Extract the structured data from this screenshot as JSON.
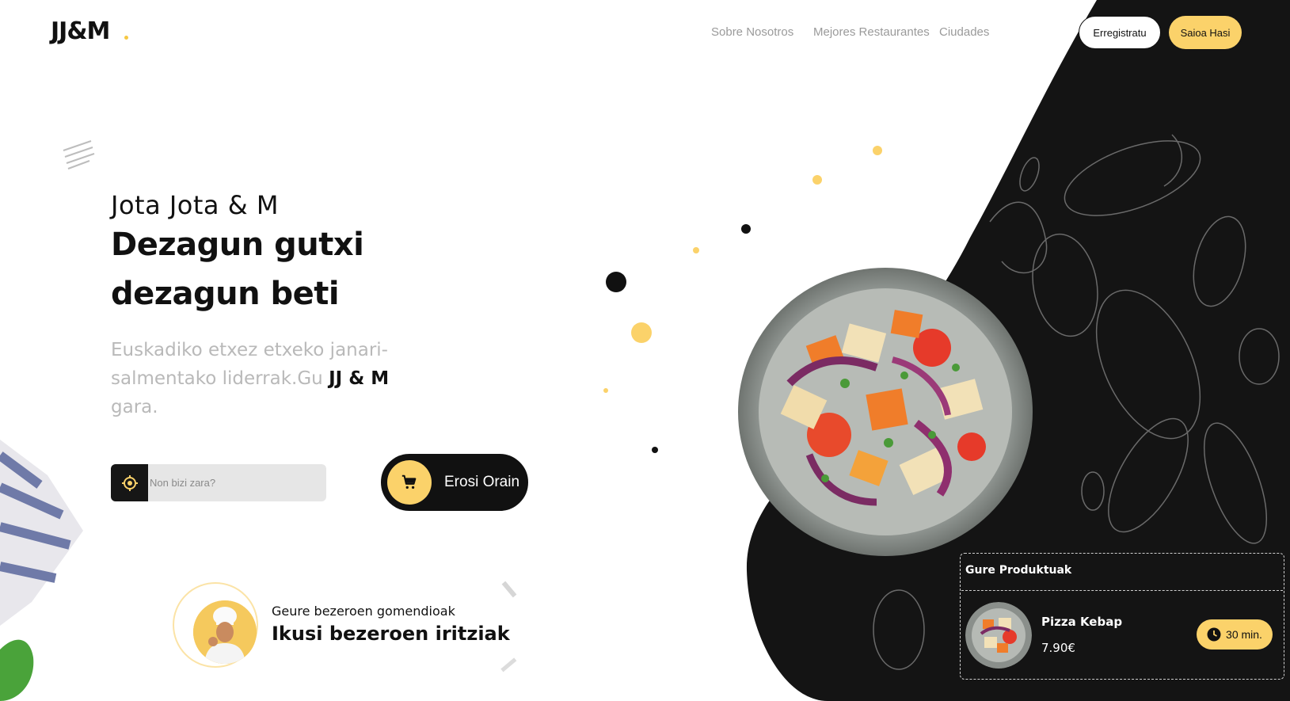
{
  "header": {
    "logo": "JJ&M",
    "nav": [
      "Sobre Nosotros",
      "Mejores Restaurantes",
      "Ciudades"
    ],
    "register_label": "Erregistratu",
    "login_label": "Saioa Hasi"
  },
  "hero": {
    "subtitle": "Jota Jota & M",
    "headline": "Dezagun gutxi dezagun beti",
    "description_part1": "Euskadiko etxez etxeko janari-salmentako liderrak.Gu",
    "description_brand": "JJ & M",
    "description_part2": "gara."
  },
  "search": {
    "placeholder": "Non bizi zara?",
    "value": "",
    "icon": "location-target-icon"
  },
  "buy_button": {
    "label": "Erosi Orain",
    "icon": "cart-icon"
  },
  "reviews": {
    "small": "Geure bezeroen gomendioak",
    "big": "Ikusi bezeroen iritziak"
  },
  "products_card": {
    "title": "Gure Produktuak",
    "product_name": "Pizza Kebap",
    "price": "7.90€",
    "time": "30 min.",
    "time_icon": "clock-icon"
  },
  "colors": {
    "accent": "#fbd26a",
    "dark": "#141414",
    "muted_text": "#b9b9b9"
  }
}
